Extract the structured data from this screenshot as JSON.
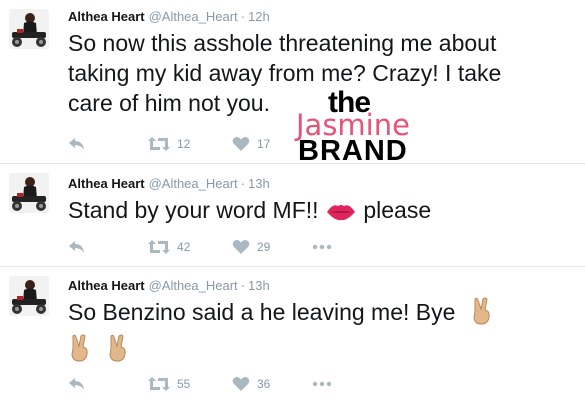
{
  "tweets": [
    {
      "name": "Althea Heart",
      "handle": "@Althea_Heart",
      "separator": "·",
      "time": "12h",
      "lines": [
        "So now this asshole threatening me about",
        "taking my kid away from me? Crazy! I take",
        "care of him not you."
      ],
      "retweets": "12",
      "likes": "17"
    },
    {
      "name": "Althea Heart",
      "handle": "@Althea_Heart",
      "separator": "·",
      "time": "13h",
      "text_before": "Stand by your word MF!!",
      "text_after": "please",
      "emoji": "kiss-lips-icon",
      "retweets": "42",
      "likes": "29"
    },
    {
      "name": "Althea Heart",
      "handle": "@Althea_Heart",
      "separator": "·",
      "time": "13h",
      "text": "So Benzino said a he leaving me!  Bye",
      "emoji": "victory-hand-icon",
      "retweets": "55",
      "likes": "36"
    }
  ],
  "watermark": {
    "the": "the",
    "jasmine": "Jasmine",
    "brand": "BRAND"
  },
  "colors": {
    "meta": "#8899a6",
    "text": "#14171a",
    "divider": "#e1e8ed",
    "brand_pink": "#e8537a"
  }
}
